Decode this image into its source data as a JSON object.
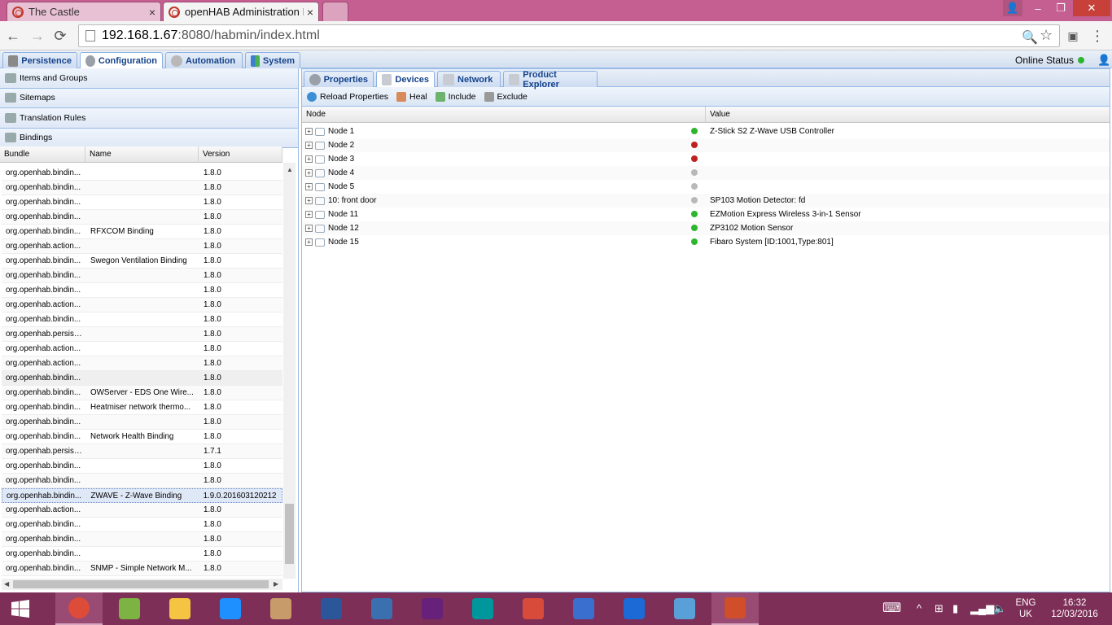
{
  "browser": {
    "tabs": [
      {
        "title": "The Castle",
        "close": "×"
      },
      {
        "title": "openHAB Administration I",
        "close": "×"
      }
    ],
    "url_host": "192.168.1.67",
    "url_rest": ":8080/habmin/index.html",
    "window_controls": {
      "user": "👤",
      "minimize": "–",
      "maximize": "❐",
      "close": "✕"
    },
    "nav": {
      "back": "←",
      "forward": "→",
      "reload": "⟳",
      "zoom": "🔍",
      "star": "☆",
      "menu": "⋮"
    }
  },
  "app": {
    "top_tabs": [
      "Persistence",
      "Configuration",
      "Automation",
      "System"
    ],
    "active_top_tab": "Configuration",
    "online_status": "Online Status",
    "online_color": "#2db52d",
    "accordion": [
      "Items and Groups",
      "Sitemaps",
      "Translation Rules",
      "Bindings"
    ],
    "grid_headers": [
      "Bundle",
      "Name",
      "Version"
    ],
    "bindings": [
      {
        "bundle": "org.openhab.bindin...",
        "name": "",
        "version": "1.8.0"
      },
      {
        "bundle": "org.openhab.bindin...",
        "name": "",
        "version": "1.8.0"
      },
      {
        "bundle": "org.openhab.bindin...",
        "name": "",
        "version": "1.8.0"
      },
      {
        "bundle": "org.openhab.bindin...",
        "name": "",
        "version": "1.8.0"
      },
      {
        "bundle": "org.openhab.bindin...",
        "name": "RFXCOM Binding",
        "version": "1.8.0"
      },
      {
        "bundle": "org.openhab.action...",
        "name": "",
        "version": "1.8.0"
      },
      {
        "bundle": "org.openhab.bindin...",
        "name": "Swegon Ventilation Binding",
        "version": "1.8.0"
      },
      {
        "bundle": "org.openhab.bindin...",
        "name": "",
        "version": "1.8.0"
      },
      {
        "bundle": "org.openhab.bindin...",
        "name": "",
        "version": "1.8.0"
      },
      {
        "bundle": "org.openhab.action...",
        "name": "",
        "version": "1.8.0"
      },
      {
        "bundle": "org.openhab.bindin...",
        "name": "",
        "version": "1.8.0"
      },
      {
        "bundle": "org.openhab.persist...",
        "name": "",
        "version": "1.8.0"
      },
      {
        "bundle": "org.openhab.action...",
        "name": "",
        "version": "1.8.0"
      },
      {
        "bundle": "org.openhab.action...",
        "name": "",
        "version": "1.8.0"
      },
      {
        "bundle": "org.openhab.bindin...",
        "name": "",
        "version": "1.8.0"
      },
      {
        "bundle": "org.openhab.bindin...",
        "name": "OWServer - EDS One Wire...",
        "version": "1.8.0"
      },
      {
        "bundle": "org.openhab.bindin...",
        "name": "Heatmiser network thermo...",
        "version": "1.8.0"
      },
      {
        "bundle": "org.openhab.bindin...",
        "name": "",
        "version": "1.8.0"
      },
      {
        "bundle": "org.openhab.bindin...",
        "name": "Network Health Binding",
        "version": "1.8.0"
      },
      {
        "bundle": "org.openhab.persist...",
        "name": "",
        "version": "1.7.1"
      },
      {
        "bundle": "org.openhab.bindin...",
        "name": "",
        "version": "1.8.0"
      },
      {
        "bundle": "org.openhab.bindin...",
        "name": "",
        "version": "1.8.0"
      },
      {
        "bundle": "org.openhab.bindin...",
        "name": "ZWAVE - Z-Wave Binding",
        "version": "1.9.0.201603120212"
      },
      {
        "bundle": "org.openhab.action...",
        "name": "",
        "version": "1.8.0"
      },
      {
        "bundle": "org.openhab.bindin...",
        "name": "",
        "version": "1.8.0"
      },
      {
        "bundle": "org.openhab.bindin...",
        "name": "",
        "version": "1.8.0"
      },
      {
        "bundle": "org.openhab.bindin...",
        "name": "",
        "version": "1.8.0"
      },
      {
        "bundle": "org.openhab.bindin...",
        "name": "SNMP - Simple Network M...",
        "version": "1.8.0"
      }
    ],
    "right_tabs": [
      "Properties",
      "Devices",
      "Network",
      "Product Explorer"
    ],
    "active_right_tab": "Devices",
    "toolbar": [
      "Reload Properties",
      "Heal",
      "Include",
      "Exclude"
    ],
    "device_headers": [
      "Node",
      "Value"
    ],
    "status_colors": {
      "green": "#2db52d",
      "red": "#c0201f",
      "grey": "#b8b8b8"
    },
    "devices": [
      {
        "node": "Node 1",
        "status": "green",
        "value": "Z-Stick S2 Z-Wave USB Controller"
      },
      {
        "node": "Node 2",
        "status": "red",
        "value": ""
      },
      {
        "node": "Node 3",
        "status": "red",
        "value": ""
      },
      {
        "node": "Node 4",
        "status": "grey",
        "value": ""
      },
      {
        "node": "Node 5",
        "status": "grey",
        "value": ""
      },
      {
        "node": "10: front door",
        "status": "grey",
        "value": "SP103 Motion Detector: fd"
      },
      {
        "node": "Node 11",
        "status": "green",
        "value": "EZMotion Express Wireless 3-in-1 Sensor"
      },
      {
        "node": "Node 12",
        "status": "green",
        "value": "ZP3102 Motion Sensor"
      },
      {
        "node": "Node 15",
        "status": "green",
        "value": "Fibaro System [ID:1001,Type:801]"
      }
    ]
  },
  "taskbar": {
    "apps": [
      "chrome-icon",
      "minecraft-icon",
      "file-explorer-icon",
      "internet-explorer-icon",
      "paint-icon",
      "word-icon",
      "remote-desktop-icon",
      "visual-studio-icon",
      "arduino-icon",
      "processing-icon",
      "network-tool-icon",
      "mail-icon",
      "people-icon",
      "pdf-icon"
    ],
    "lang_line1": "ENG",
    "lang_line2": "UK",
    "time": "16:32",
    "date": "12/03/2016"
  }
}
